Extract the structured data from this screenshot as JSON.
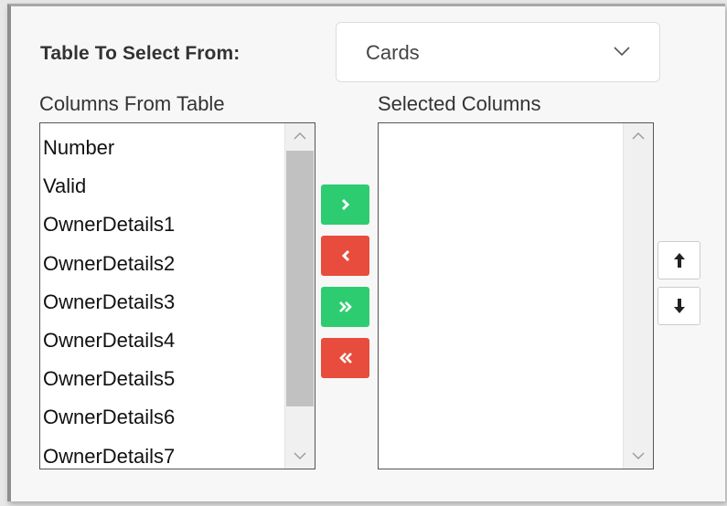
{
  "form": {
    "table_label": "Table To Select From:",
    "table_selected": "Cards"
  },
  "available": {
    "header": "Columns From Table",
    "items": [
      "Number",
      "Valid",
      "OwnerDetails1",
      "OwnerDetails2",
      "OwnerDetails3",
      "OwnerDetails4",
      "OwnerDetails5",
      "OwnerDetails6",
      "OwnerDetails7"
    ]
  },
  "selected": {
    "header": "Selected Columns",
    "items": []
  },
  "buttons": [
    {
      "name": "add-selected-button",
      "icon": "chevron-right-icon",
      "color": "#2ecc71"
    },
    {
      "name": "remove-selected-button",
      "icon": "chevron-left-icon",
      "color": "#e74c3c"
    },
    {
      "name": "add-all-button",
      "icon": "double-chevron-right-icon",
      "color": "#2ecc71"
    },
    {
      "name": "remove-all-button",
      "icon": "double-chevron-left-icon",
      "color": "#e74c3c"
    },
    {
      "name": "move-up-button",
      "icon": "arrow-up-icon"
    },
    {
      "name": "move-down-button",
      "icon": "arrow-down-icon"
    }
  ],
  "colors": {
    "add": "#2ecc71",
    "remove": "#e74c3c",
    "scroll_thumb": "#c1c1c1"
  }
}
